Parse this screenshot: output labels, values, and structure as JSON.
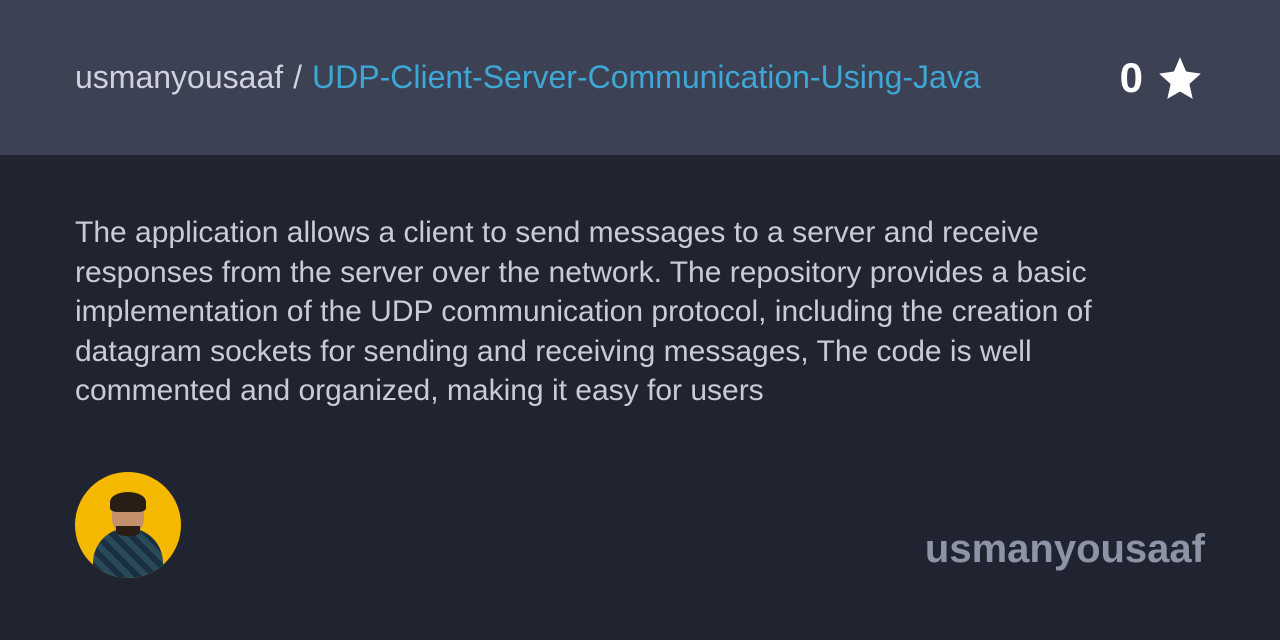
{
  "header": {
    "owner": "usmanyousaaf",
    "separator": "/",
    "repo": "UDP-Client-Server-Communication-Using-Java",
    "star_count": "0"
  },
  "main": {
    "description": "The application allows a client to send messages to a server and receive responses from the server over the network. The repository provides a basic implementation of the UDP communication protocol, including the creation of datagram sockets for sending and receiving messages, The code is well commented and organized, making it easy for users"
  },
  "footer": {
    "username": "usmanyousaaf"
  },
  "colors": {
    "header_bg": "#3c4154",
    "body_bg": "#1f2430",
    "link_color": "#3fa7d6",
    "text_primary": "#d0d3dc",
    "text_secondary": "#8e94a6",
    "avatar_bg": "#f5b800"
  }
}
